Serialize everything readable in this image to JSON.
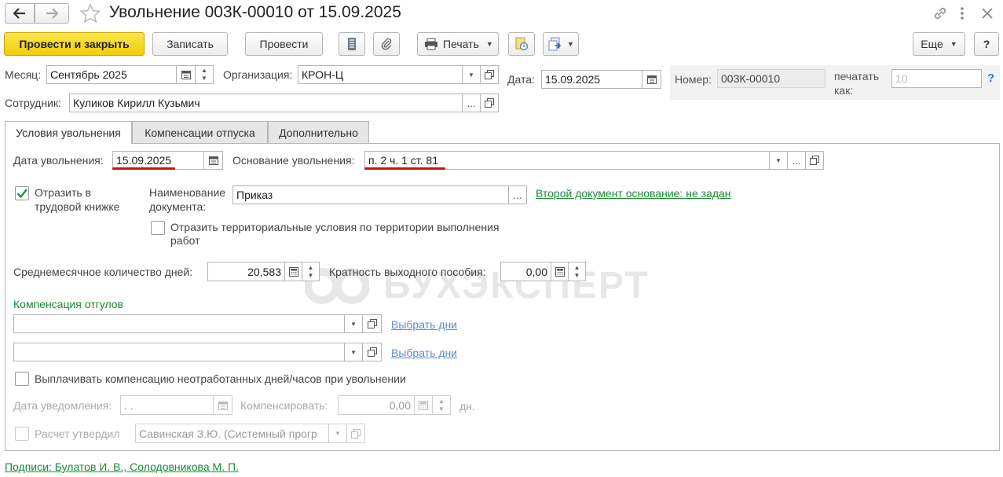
{
  "window": {
    "title": "Увольнение 003К-00010 от 15.09.2025"
  },
  "toolbar": {
    "post_close": "Провести и закрыть",
    "save": "Записать",
    "post": "Провести",
    "print": "Печать",
    "more": "Еще",
    "help": "?"
  },
  "header": {
    "month_label": "Месяц:",
    "month_value": "Сентябрь 2025",
    "org_label": "Организация:",
    "org_value": "КРОН-Ц",
    "date_label": "Дата:",
    "date_value": "15.09.2025",
    "number_label": "Номер:",
    "number_value": "003К-00010",
    "print_as_label_1": "печатать",
    "print_as_label_2": "как:",
    "print_as_placeholder": "10",
    "help_link": "?",
    "employee_label": "Сотрудник:",
    "employee_value": "Куликов Кирилл Кузьмич"
  },
  "tabs": [
    {
      "label": "Условия увольнения",
      "active": true
    },
    {
      "label": "Компенсации отпуска",
      "active": false
    },
    {
      "label": "Дополнительно",
      "active": false
    }
  ],
  "form": {
    "dismissal_date_label": "Дата увольнения:",
    "dismissal_date_value": "15.09.2025",
    "reason_label": "Основание увольнения:",
    "reason_value": "п. 2 ч. 1 ст. 81",
    "workbook_label_1": "Отразить в",
    "workbook_label_2": "трудовой книжке",
    "workbook_checked": true,
    "doc_name_label_1": "Наименование",
    "doc_name_label_2": "документа:",
    "doc_name_value": "Приказ",
    "second_doc_link": "Второй документ основание: не задан",
    "territorial_label_1": "Отразить территориальные условия по территории выполнения",
    "territorial_label_2": "работ",
    "territorial_checked": false,
    "avg_days_label": "Среднемесячное количество дней:",
    "avg_days_value": "20,583",
    "severance_label": "Кратность выходного пособия:",
    "severance_value": "0,00",
    "time_off_section": "Компенсация отгулов",
    "select_days_1": "Выбрать дни",
    "select_days_2": "Выбрать дни",
    "pay_comp_label": "Выплачивать компенсацию неотработанных дней/часов при увольнении",
    "pay_comp_checked": false,
    "notice_date_label": "Дата уведомления:",
    "notice_date_value": " .  .",
    "compensate_label": "Компенсировать:",
    "compensate_value": "0,00",
    "days_unit": "дн.",
    "approved_label": "Расчет утвердил",
    "approved_value": "Савинская З.Ю. (Системный прогр"
  },
  "footer": {
    "signatures_link": "Подписи: Булатов И. В., Солодовникова М. П."
  },
  "watermark": "БУХЭКСПЕРТ",
  "colors": {
    "primary_button": "#f2cc0c",
    "link_green": "#1b8a36",
    "link_blue": "#5b8bd0",
    "underline_red": "#d01010",
    "check_green": "#1a9a3a"
  }
}
